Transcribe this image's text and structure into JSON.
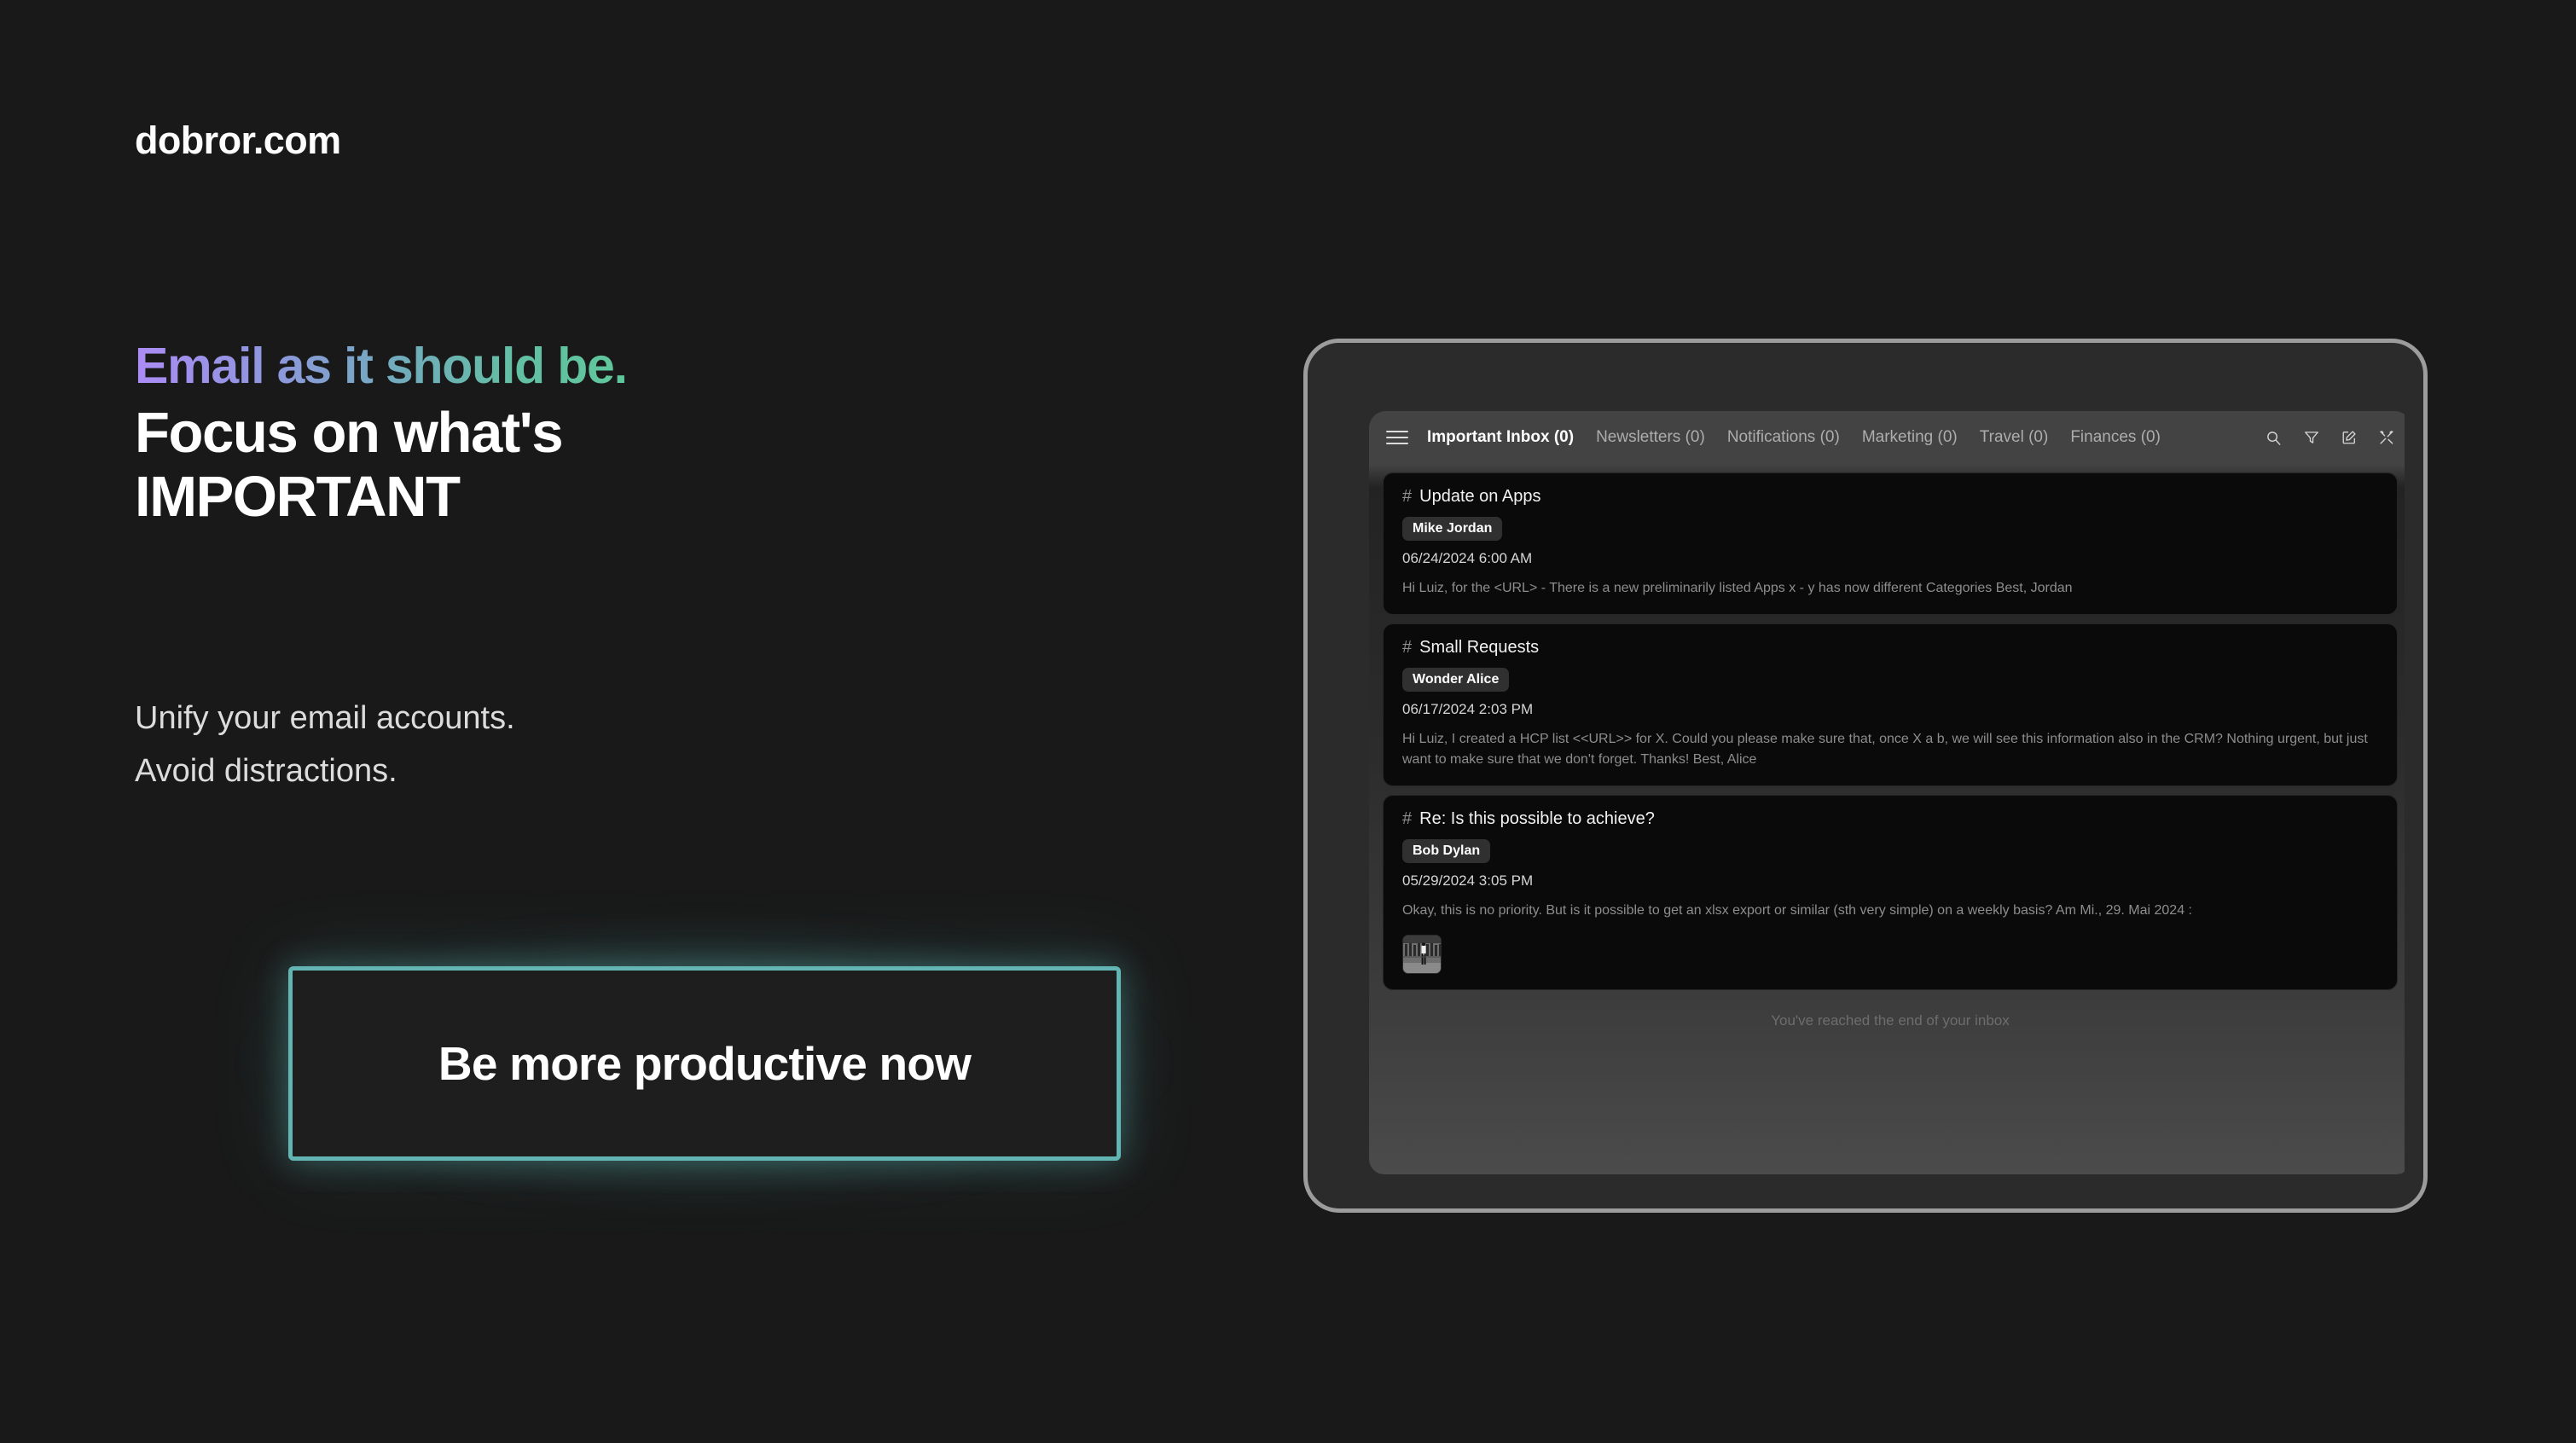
{
  "brand": {
    "logo": "dobror.com",
    "accent_teal": "#62b5b2",
    "gradient_start": "#ab8cf5",
    "gradient_end": "#5fc79b",
    "page_background": "#191919"
  },
  "hero": {
    "eyebrow": "Email as it should be.",
    "headline_line1": "Focus on what's",
    "headline_line2": "IMPORTANT",
    "subcopy_line1": "Unify your email accounts.",
    "subcopy_line2": "Avoid distractions.",
    "cta_label": "Be more productive now"
  },
  "app": {
    "menu_icon": "hamburger-menu-icon",
    "tabs": [
      {
        "label": "Important Inbox (0)",
        "active": true
      },
      {
        "label": "Newsletters (0)",
        "active": false
      },
      {
        "label": "Notifications (0)",
        "active": false
      },
      {
        "label": "Marketing (0)",
        "active": false
      },
      {
        "label": "Travel (0)",
        "active": false
      },
      {
        "label": "Finances (0)",
        "active": false
      }
    ],
    "tool_icons": [
      "search-icon",
      "filter-icon",
      "compose-icon",
      "tools-icon"
    ],
    "emails": [
      {
        "hash": "#",
        "subject": "Update on Apps",
        "sender": "Mike Jordan",
        "date": "06/24/2024 6:00 AM",
        "preview": "Hi Luiz, for the <URL> - There is a new preliminarily listed Apps x - y has now different Categories  Best, Jordan",
        "has_attachment": false
      },
      {
        "hash": "#",
        "subject": "Small Requests",
        "sender": "Wonder Alice",
        "date": "06/17/2024 2:03 PM",
        "preview": "Hi Luiz, I created a HCP list <<URL>> for X. Could you please make sure that, once X a b, we will see this information also in the CRM? Nothing urgent, but just want to make sure that we don't forget. Thanks! Best, Alice",
        "has_attachment": false
      },
      {
        "hash": "#",
        "subject": "Re: Is this possible to achieve?",
        "sender": "Bob Dylan",
        "date": "05/29/2024 3:05 PM",
        "preview": "Okay, this is no priority. But is it possible to get an xlsx export or similar (sth very simple) on a weekly basis? Am Mi., 29. Mai 2024 :",
        "has_attachment": true,
        "attachment_name": "photo-thumbnail"
      }
    ],
    "end_of_list": "You've reached the end of your inbox"
  }
}
